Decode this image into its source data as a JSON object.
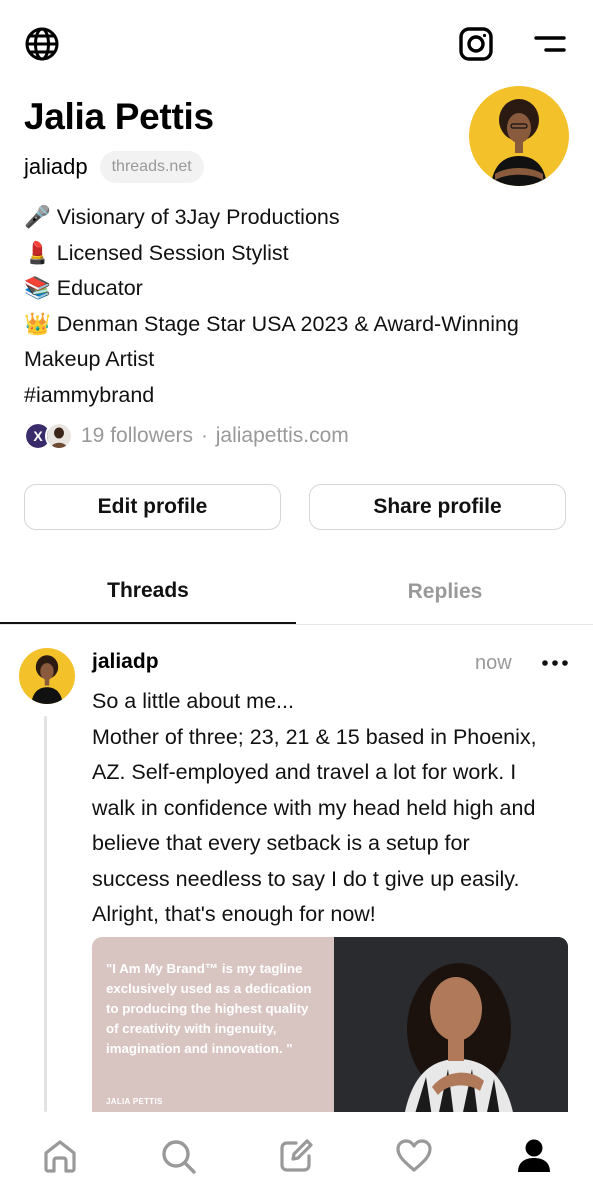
{
  "header": {
    "name": "Jalia Pettis",
    "handle": "jaliadp",
    "domain_badge": "threads.net"
  },
  "bio": [
    {
      "emoji": "🎤",
      "text": "Visionary of 3Jay Productions"
    },
    {
      "emoji": "💄",
      "text": "Licensed Session Stylist"
    },
    {
      "emoji": "📚",
      "text": "Educator"
    },
    {
      "emoji": "👑",
      "text": "Denman Stage Star USA 2023 & Award-Winning"
    },
    {
      "emoji": "",
      "text": "Makeup Artist"
    },
    {
      "emoji": "",
      "text": "#iammybrand"
    }
  ],
  "followers": {
    "text": "19 followers",
    "separator": "·",
    "website": "jaliapettis.com"
  },
  "buttons": {
    "edit": "Edit profile",
    "share": "Share profile"
  },
  "tabs": {
    "threads": "Threads",
    "replies": "Replies"
  },
  "post": {
    "author": "jaliadp",
    "time": "now",
    "lines": [
      "So a little about me...",
      "Mother of three; 23, 21 & 15 based in Phoenix,",
      "AZ. Self-employed and travel a lot for work. I",
      "walk in confidence with my head held high and",
      "believe that every setback is a setup for",
      "success needless to say I do t give up easily.",
      "Alright, that's enough for now!"
    ],
    "image": {
      "quote": "\"I Am My Brand™ is my tagline exclusively used as a dedication to producing the highest quality of creativity with ingenuity, imagination and innovation. \"",
      "quote_author": "JALIA PETTIS"
    }
  },
  "colors": {
    "text": "#111111",
    "muted": "#999999",
    "border": "#d6d6d6",
    "avatar_bg": "#f3c12a",
    "quote_bg": "#d8c4c1"
  },
  "icons": {
    "top_left": "globe-icon",
    "top_right": [
      "instagram-icon",
      "menu-icon"
    ],
    "nav": [
      "home-icon",
      "search-icon",
      "compose-icon",
      "heart-icon",
      "profile-icon"
    ]
  }
}
